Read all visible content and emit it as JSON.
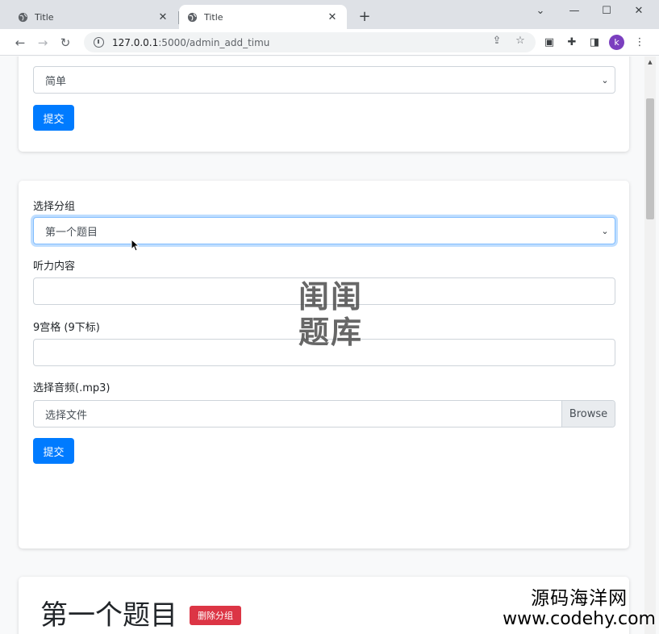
{
  "browser": {
    "tabs": [
      {
        "title": "Title",
        "active": false
      },
      {
        "title": "Title",
        "active": true
      }
    ],
    "url_host": "127.0.0.1",
    "url_path": ":5000/admin_add_timu",
    "avatar_letter": "k"
  },
  "card1": {
    "difficulty_value": "简单",
    "submit_label": "提交"
  },
  "card2": {
    "group_label": "选择分组",
    "group_value": "第一个题目",
    "listening_label": "听力内容",
    "listening_value": "",
    "grid_label": "9宫格 (9下标)",
    "grid_value": "",
    "audio_label": "选择音频(.mp3)",
    "file_placeholder": "选择文件",
    "browse_label": "Browse",
    "submit_label": "提交"
  },
  "card3": {
    "group_title": "第一个题目",
    "delete_label": "删除分组"
  },
  "watermark": {
    "line1": "闺闺",
    "line2": "题库",
    "site_cn": "源码海洋网",
    "site_url": "www.codehy.com"
  },
  "colors": {
    "primary": "#007bff",
    "danger": "#dc3545"
  }
}
